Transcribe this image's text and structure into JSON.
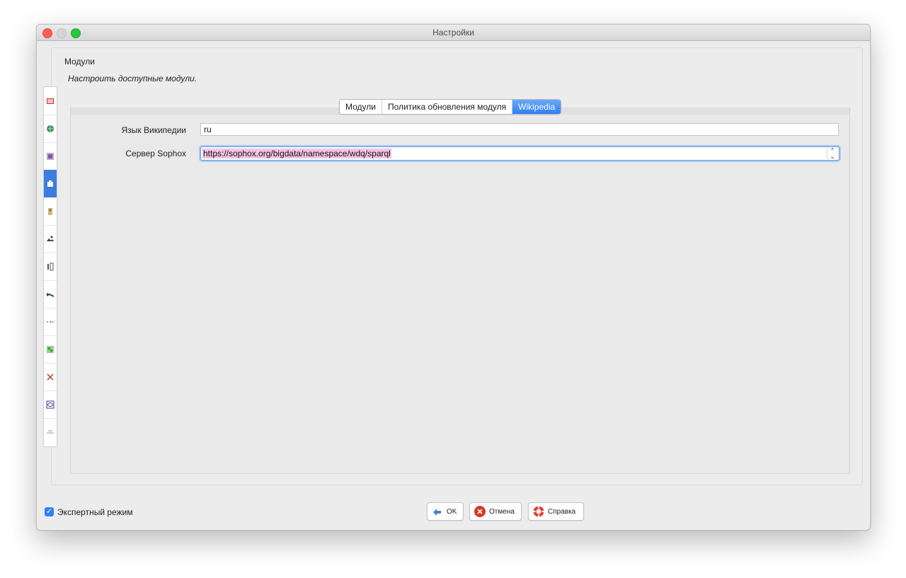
{
  "window": {
    "title": "Настройки"
  },
  "section": {
    "title": "Модули",
    "description": "Настроить доступные модули."
  },
  "sidebar": {
    "items": [
      {
        "icon": "display-settings-icon",
        "color": "#c0392b"
      },
      {
        "icon": "globe-icon",
        "color": "#3a8f5a"
      },
      {
        "icon": "map-style-icon",
        "color": "#7a5c9e"
      },
      {
        "icon": "plugin-icon",
        "color": "#ffffff",
        "active": true
      },
      {
        "icon": "remote-control-icon",
        "color": "#7a6a30"
      },
      {
        "icon": "imagery-icon",
        "color": "#2d3e50"
      },
      {
        "icon": "audio-icon",
        "color": "#555555"
      },
      {
        "icon": "validator-icon",
        "color": "#1f4f6e"
      },
      {
        "icon": "shortcut-icon",
        "color": "#888888"
      },
      {
        "icon": "presets-icon",
        "color": "#3e8e41"
      },
      {
        "icon": "connection-icon",
        "color": "#b03a3a"
      },
      {
        "icon": "projection-icon",
        "color": "#3a3a8e"
      },
      {
        "icon": "advanced-icon",
        "color": "#9a9a9a"
      }
    ]
  },
  "tabs": [
    {
      "label": "Модули",
      "selected": false
    },
    {
      "label": "Политика обновления модуля",
      "selected": false
    },
    {
      "label": "Wikipedia",
      "selected": true
    }
  ],
  "form": {
    "language_label": "Язык Википедии",
    "language_value": "ru",
    "server_label": "Сервер Sophox",
    "server_value": "https://sophox.org/bigdata/namespace/wdq/sparql"
  },
  "footer": {
    "expert_mode_label": "Экспертный режим",
    "expert_mode_checked": true,
    "ok_label": "OK",
    "cancel_label": "Отмена",
    "help_label": "Справка"
  }
}
